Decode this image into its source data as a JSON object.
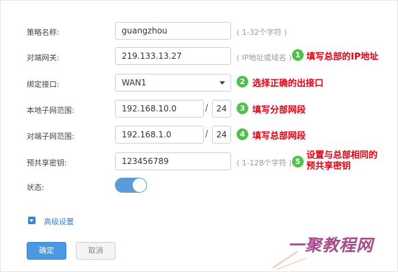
{
  "form": {
    "policy_name": {
      "label": "策略名称:",
      "value": "guangzhou",
      "hint": "( 1-32个字符 )"
    },
    "peer_gateway": {
      "label": "对端网关:",
      "value": "219.133.13.27",
      "hint": "( IP地址或域名 )"
    },
    "bind_interface": {
      "label": "绑定接口:",
      "value": "WAN1"
    },
    "local_subnet": {
      "label": "本地子网范围:",
      "ip": "192.168.10.0",
      "mask": "24",
      "separator": "/"
    },
    "peer_subnet": {
      "label": "对端子网范围:",
      "ip": "192.168.1.0",
      "mask": "24",
      "separator": "/"
    },
    "psk": {
      "label": "预共享密钥:",
      "value": "123456789",
      "hint": "( 1-128个字符 )"
    },
    "status": {
      "label": "状态:",
      "enabled": true
    },
    "advanced": {
      "label": "高级设置"
    },
    "buttons": {
      "ok": "确定",
      "cancel": "取消"
    }
  },
  "annotations": [
    {
      "num": "1",
      "text": "填写总部的IP地址"
    },
    {
      "num": "2",
      "text": "选择正确的出接口"
    },
    {
      "num": "3",
      "text": "填写分部网段"
    },
    {
      "num": "4",
      "text": "填写总部网段"
    },
    {
      "num": "5",
      "line1": "设置与总部相同的",
      "line2": "预共享密钥"
    }
  ],
  "watermark": {
    "text": "一聚教程网"
  },
  "colors": {
    "accent": "#4a97e2",
    "toggle_on": "#5b9bd9",
    "badge": "#4ec14a",
    "note": "#e60012"
  }
}
